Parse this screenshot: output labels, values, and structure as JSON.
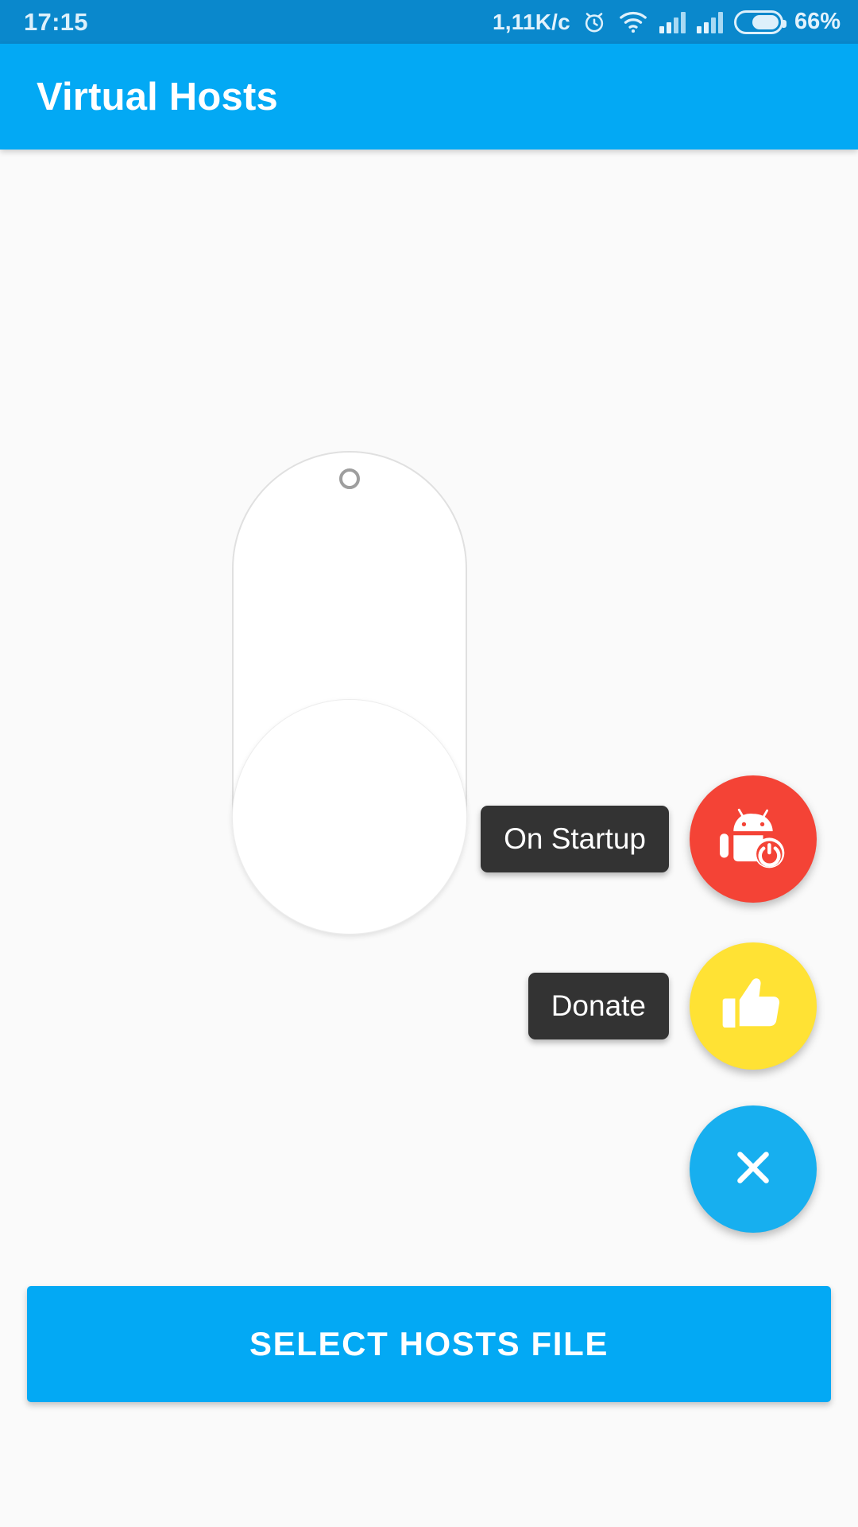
{
  "status_bar": {
    "time": "17:15",
    "network_speed": "1,11K/c",
    "battery_percent": "66%",
    "battery_level": 66,
    "icons": [
      "alarm-icon",
      "wifi-icon",
      "signal-icon",
      "signal-icon",
      "battery-icon"
    ],
    "background_color": "#0A88CC"
  },
  "app_bar": {
    "title": "Virtual Hosts",
    "background_color": "#03A9F4",
    "text_color": "#FFFFFF"
  },
  "main": {
    "toggle": {
      "name": "master-toggle",
      "state": "off",
      "border_color": "#E0E0E0",
      "fill_color": "#FFFFFF"
    },
    "background_color": "#FAFAFA"
  },
  "fab_menu": {
    "expanded": true,
    "items": [
      {
        "label": "On Startup",
        "icon": "android-power-icon",
        "color": "#F44336"
      },
      {
        "label": "Donate",
        "icon": "thumbs-up-icon",
        "color": "#FFE234"
      },
      {
        "label": "",
        "icon": "close-icon",
        "color": "#17AFEF"
      }
    ],
    "label_background": "#333333",
    "label_text_color": "#FFFFFF"
  },
  "bottom_button": {
    "label": "SELECT HOSTS FILE",
    "color": "#03A9F4",
    "text_color": "#FFFFFF"
  }
}
